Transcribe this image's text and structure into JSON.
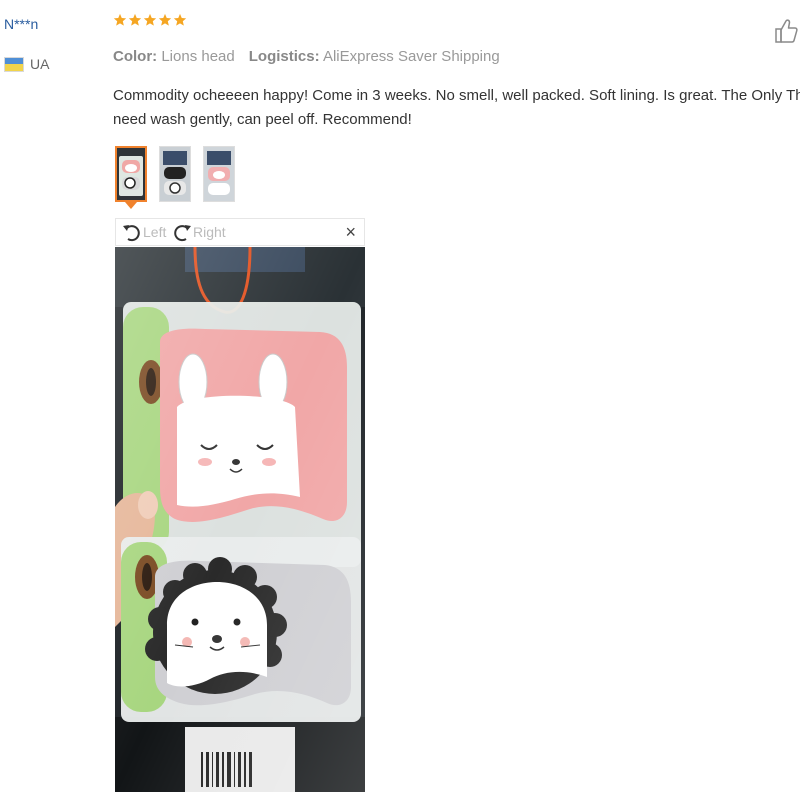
{
  "reviewer": {
    "name": "N***n",
    "country_code": "UA",
    "flag_colors": [
      "#4f8fd6",
      "#f1d44b"
    ]
  },
  "rating": {
    "stars": 5,
    "max": 5,
    "color": "#f5a623"
  },
  "meta": {
    "color_label": "Color:",
    "color_value": "Lions head",
    "logistics_label": "Logistics:",
    "logistics_value": "AliExpress Saver Shipping"
  },
  "review": {
    "line1": "Commodity ocheeeen happy! Come in 3 weeks. No smell, well packed. Soft lining. Is great. The Only Thing that is confusing-print",
    "line2": "need wash gently, can peel off. Recommend!"
  },
  "thumbnails": [
    {
      "id": "photo-1",
      "active": true
    },
    {
      "id": "photo-2",
      "active": false
    },
    {
      "id": "photo-3",
      "active": false
    }
  ],
  "viewer": {
    "rotate_left_label": "Left",
    "rotate_right_label": "Right",
    "close_label": "×"
  },
  "icons": {
    "thumbs_up": "thumbs-up-icon",
    "rotate_left": "rotate-left-icon",
    "rotate_right": "rotate-right-icon",
    "close": "close-icon",
    "star": "star-icon"
  },
  "accent_color": "#f0822d",
  "name_color": "#2a5d9f"
}
